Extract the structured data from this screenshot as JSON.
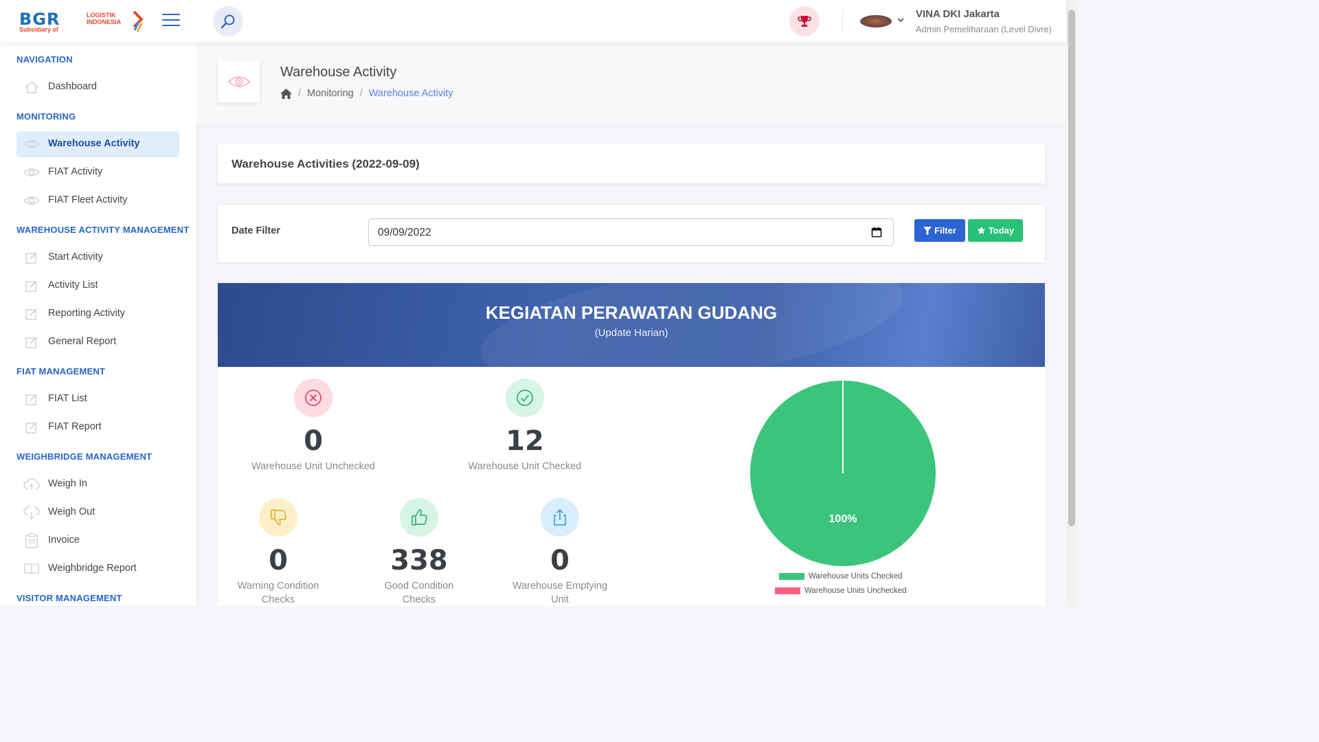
{
  "header": {
    "logo": {
      "brand": "BGR",
      "line1": "LOGISTIK",
      "line2": "INDONESIA",
      "subsidiary": "Subsidiary of"
    },
    "user": {
      "name": "VINA DKI Jakarta",
      "role": "Admin Pemeliharaan (Level Divre)"
    }
  },
  "sidebar": {
    "sections": {
      "navigation": "NAVIGATION",
      "monitoring": "MONITORING",
      "wam": "WAREHOUSE ACTIVITY MANAGEMENT",
      "fiat": "FIAT MANAGEMENT",
      "weighbridge": "WEIGHBRIDGE MANAGEMENT",
      "visitor": "VISITOR MANAGEMENT"
    },
    "items": {
      "dashboard": "Dashboard",
      "warehouse_activity": "Warehouse Activity",
      "fiat_activity": "FIAT Activity",
      "fiat_fleet_activity": "FIAT Fleet Activity",
      "start_activity": "Start Activity",
      "activity_list": "Activity List",
      "reporting_activity": "Reporting Activity",
      "general_report": "General Report",
      "fiat_list": "FIAT List",
      "fiat_report": "FIAT Report",
      "weigh_in": "Weigh In",
      "weigh_out": "Weigh Out",
      "invoice": "Invoice",
      "weighbridge_report": "Weighbridge Report"
    }
  },
  "page": {
    "title": "Warehouse Activity",
    "breadcrumb": [
      "Monitoring",
      "Warehouse Activity"
    ],
    "card_title": "Warehouse Activities (2022-09-09)"
  },
  "filter": {
    "label": "Date Filter",
    "date_value": "09/09/2022",
    "filter_button": "Filter",
    "today_button": "Today"
  },
  "banner": {
    "title": "KEGIATAN PERAWATAN GUDANG",
    "subtitle": "(Update Harian)"
  },
  "stats": {
    "unchecked": {
      "value": "0",
      "label": "Warehouse Unit Unchecked"
    },
    "checked": {
      "value": "12",
      "label": "Warehouse Unit Checked"
    },
    "warning": {
      "value": "0",
      "label": "Warning Condition Checks"
    },
    "good": {
      "value": "338",
      "label": "Good Condition Checks"
    },
    "emptying": {
      "value": "0",
      "label": "Warehouse Emptying Unit"
    }
  },
  "colors": {
    "accent": "#2a63c8",
    "checked": "#3cc47c",
    "unchecked": "#ff6384"
  },
  "chart_data": {
    "type": "pie",
    "categories": [
      "Warehouse Units Checked",
      "Warehouse Units Unchecked"
    ],
    "values": [
      12,
      0
    ],
    "labels": [
      "100%"
    ],
    "legend": [
      "Warehouse Units Checked",
      "Warehouse Units Unchecked"
    ],
    "legend_position": "bottom"
  }
}
